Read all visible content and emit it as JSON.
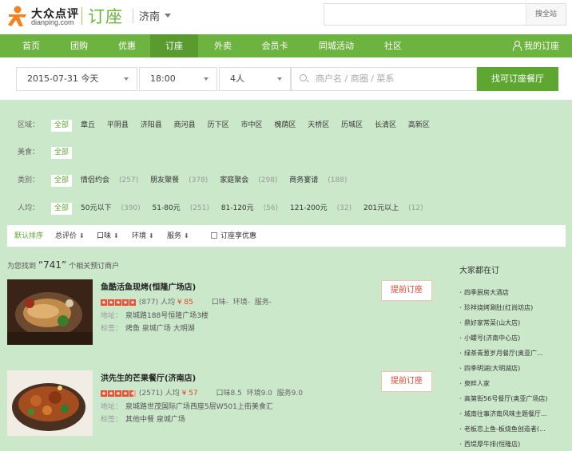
{
  "header": {
    "logo_cn": "大众点评",
    "logo_en": "dianping.com",
    "brand": "订座",
    "city": "济南",
    "search_placeholder": "",
    "search_button": "搜全站"
  },
  "nav": {
    "items": [
      "首页",
      "团购",
      "优惠",
      "订座",
      "外卖",
      "会员卡",
      "同城活动",
      "社区"
    ],
    "active": "订座",
    "my_booking": "我的订座"
  },
  "booking": {
    "date": "2015-07-31 今天",
    "time": "18:00",
    "people": "4人",
    "keyword_placeholder": "商户名 / 商圈 / 菜系",
    "find_button": "找可订座餐厅"
  },
  "filters": {
    "area": {
      "label": "区域：",
      "all": "全部",
      "options": [
        "章丘",
        "平阴县",
        "济阳县",
        "商河县",
        "历下区",
        "市中区",
        "槐荫区",
        "天桥区",
        "历城区",
        "长清区",
        "高新区"
      ]
    },
    "cuisine": {
      "label": "美食：",
      "all": "全部"
    },
    "category": {
      "label": "类别：",
      "all": "全部",
      "options": [
        {
          "name": "情侣约会",
          "count": "(257)"
        },
        {
          "name": "朋友聚餐",
          "count": "(378)"
        },
        {
          "name": "家庭聚会",
          "count": "(298)"
        },
        {
          "name": "商务宴请",
          "count": "(188)"
        }
      ]
    },
    "price": {
      "label": "人均：",
      "all": "全部",
      "options": [
        {
          "name": "50元以下",
          "count": "(390)"
        },
        {
          "name": "51-80元",
          "count": "(251)"
        },
        {
          "name": "81-120元",
          "count": "(56)"
        },
        {
          "name": "121-200元",
          "count": "(32)"
        },
        {
          "name": "201元以上",
          "count": "(12)"
        }
      ]
    }
  },
  "sort": {
    "default": "默认排序",
    "rating": "总评价",
    "taste": "口味",
    "env": "环境",
    "service": "服务",
    "promo": "订座享优惠",
    "arrow": "⬇"
  },
  "results": {
    "prefix": "为您找到",
    "count": "“741”",
    "suffix": "个相关预订商户"
  },
  "shops": [
    {
      "name": "鱼酷活鱼现烤(恒隆广场店)",
      "reviews": "(877)",
      "avg_label": "人均",
      "avg_price": "¥ 85",
      "taste": "口味-",
      "env": "环境-",
      "service": "服务-",
      "address_label": "地址：",
      "address": "泉城路188号恒隆广场3楼",
      "tags_label": "标签：",
      "tags": "烤鱼  泉城广场  大明湖",
      "rating": 5,
      "book": "提前订座"
    },
    {
      "name": "洪先生的芒果餐厅(济南店)",
      "reviews": "(2571)",
      "avg_label": "人均",
      "avg_price": "¥ 57",
      "taste": "口味8.5",
      "env": "环境9.0",
      "service": "服务9.0",
      "address_label": "地址：",
      "address": "泉城路世茂国际广场西座5层W501上街美食汇",
      "tags_label": "标签：",
      "tags": "其他中餐  泉城广场",
      "rating": 4.5,
      "book": "提前订座"
    }
  ],
  "sidebar": {
    "title": "大家都在订",
    "items": [
      "四季厨房大酒店",
      "珍祥烧烤涮肚(红尚坊店)",
      "鼎好家常菜(山大店)",
      "小螺号(济南中心店)",
      "绿茶青葱岁月餐厅(奥亚广...",
      "四季明湖(大明湖店)",
      "泉畔人家",
      "高第街56号餐厅(奥亚广场店)",
      "城南往事济南风味主题餐厅...",
      "老板恋上鱼-板烧鱼创造者(...",
      "西堤厚牛排(恒隆店)"
    ]
  },
  "colors": {
    "brand_green": "#6db33f",
    "nav_active": "#5a9b30",
    "bg_green": "#cce8cb",
    "price_red": "#e4432f"
  }
}
